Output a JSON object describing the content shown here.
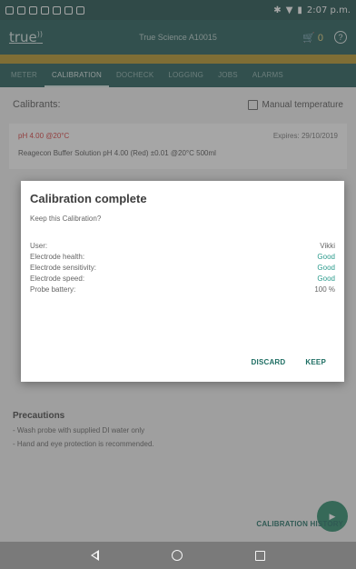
{
  "statusbar": {
    "time": "2:07 p.m."
  },
  "appbar": {
    "logo": "true",
    "title": "True Science A10015",
    "cart_count": "0",
    "help_icon": "help-icon"
  },
  "tabs": [
    {
      "label": "METER"
    },
    {
      "label": "CALIBRATION"
    },
    {
      "label": "DOCHECK"
    },
    {
      "label": "LOGGING"
    },
    {
      "label": "JOBS"
    },
    {
      "label": "ALARMS"
    }
  ],
  "calibrants": {
    "heading": "Calibrants:",
    "manual_temperature": "Manual temperature",
    "card": {
      "ph": "pH 4.00 @20°C",
      "expires": "Expires: 29/10/2019",
      "buffer": "Reagecon Buffer Solution pH 4.00 (Red) ±0.01 @20°C 500ml"
    }
  },
  "dialog": {
    "title": "Calibration complete",
    "subtitle": "Keep this Calibration?",
    "rows": [
      {
        "label": "User:",
        "value": "Vikki"
      },
      {
        "label": "Electrode health:",
        "value": "Good"
      },
      {
        "label": "Electrode sensitivity:",
        "value": "Good"
      },
      {
        "label": "Electrode speed:",
        "value": "Good"
      },
      {
        "label": "Probe battery:",
        "value": "100 %"
      }
    ],
    "discard": "DISCARD",
    "keep": "KEEP"
  },
  "precautions": {
    "title": "Precautions",
    "items": [
      "- Wash probe with supplied DI water only",
      "- Hand and eye protection is recommended."
    ]
  },
  "history_button": "CALIBRATION HISTORY",
  "colors": {
    "primary": "#215a56",
    "accent": "#2a9a8c",
    "warning": "#d93b3b",
    "band": "#b59528"
  }
}
